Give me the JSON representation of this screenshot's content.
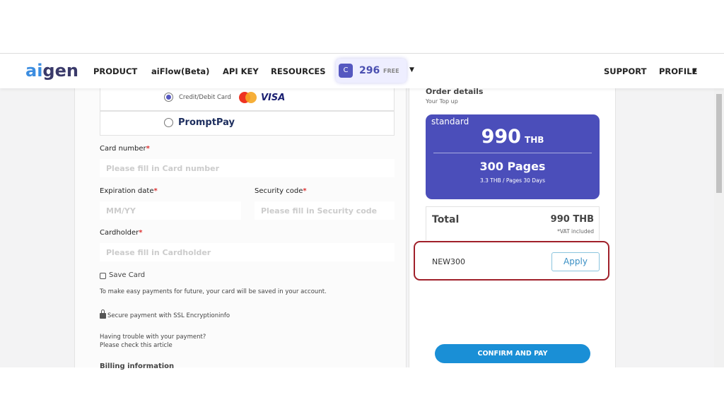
{
  "nav": {
    "logo": "aigen",
    "items": [
      "PRODUCT",
      "aiFlow(Beta)",
      "API KEY",
      "RESOURCES"
    ],
    "credit_icon": "C",
    "credits": "296",
    "credit_type": "FREE",
    "support": "SUPPORT",
    "profile": "PROFILE"
  },
  "payment": {
    "credit_label": "Credit/Debit Card",
    "visa": "VISA",
    "promptpay": "PromptPay",
    "selected": "Credit/Debit Card"
  },
  "form": {
    "card_number_label": "Card number",
    "card_number_placeholder": "Please fill in Card number",
    "expiration_label": "Expiration date",
    "expiration_placeholder": "MM/YY",
    "security_label": "Security code",
    "security_placeholder": "Please fill in Security code",
    "cardholder_label": "Cardholder",
    "cardholder_placeholder": "Please fill in Cardholder",
    "required_mark": "*",
    "save_card": "Save Card",
    "save_note": "To make easy payments for future, your card will be saved in your account.",
    "secure": "Secure payment with SSL Encryptioninfo",
    "trouble1": "Having trouble with your payment?",
    "trouble2": "Please check this article",
    "billing": "Billing information"
  },
  "order": {
    "title": "Order details",
    "subtitle": "Your Top up",
    "plan": "standard",
    "price": "990",
    "currency": "THB",
    "pages": "300 Pages",
    "rate": "3.3 THB / Pages 30 Days",
    "total_label": "Total",
    "total": "990 THB",
    "vat": "*VAT included",
    "coupon": "NEW300",
    "apply": "Apply",
    "confirm": "CONFIRM AND PAY"
  },
  "colors": {
    "accent": "#4b4eba",
    "confirm": "#1a8fd6",
    "highlight": "#a0202a"
  }
}
